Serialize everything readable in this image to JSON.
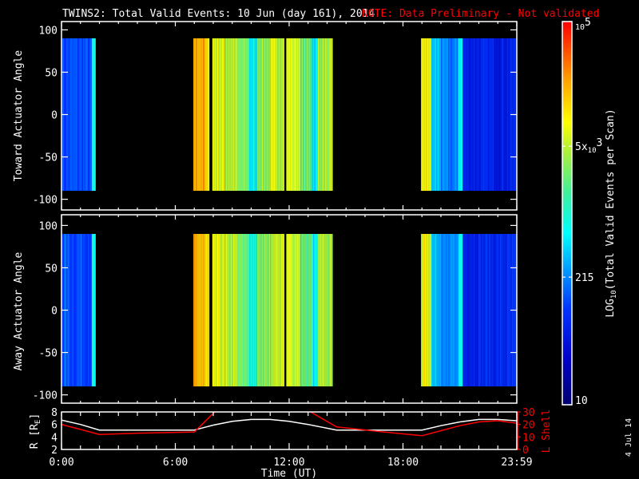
{
  "title": {
    "main": "TWINS2: Total Valid Events: 10 Jun (day 161), 2014",
    "note": "NOTE: Data Preliminary - Not validated"
  },
  "side_date": "4 Jul 14",
  "colors": {
    "note": "#ff0000",
    "axes": "#ffffff",
    "r_line": "#ffffff",
    "l_line": "#ff0000",
    "background": "#000000"
  },
  "chart_data": [
    {
      "type": "heatmap",
      "name": "toward",
      "ylabel": "Toward Actuator Angle",
      "ylim": [
        -100,
        100
      ],
      "yticks": [
        "100",
        "50",
        "0",
        "-50",
        "-100"
      ],
      "ytick_values": [
        100,
        50,
        0,
        -50,
        -100
      ],
      "angle_range": [
        -90,
        90
      ],
      "xlim_hours": [
        0,
        24
      ],
      "segments": [
        {
          "start": 0.0,
          "end": 1.6,
          "count": 120
        },
        {
          "start": 1.6,
          "end": 1.8,
          "count": 650
        },
        {
          "start": 6.95,
          "end": 7.55,
          "count": 22000
        },
        {
          "start": 7.55,
          "end": 7.8,
          "count": 11000
        },
        {
          "start": 7.95,
          "end": 8.6,
          "count": 7000
        },
        {
          "start": 8.6,
          "end": 9.3,
          "count": 5200
        },
        {
          "start": 9.3,
          "end": 9.9,
          "count": 2600
        },
        {
          "start": 9.9,
          "end": 10.3,
          "count": 600
        },
        {
          "start": 10.3,
          "end": 11.0,
          "count": 3600
        },
        {
          "start": 11.0,
          "end": 11.75,
          "count": 6000
        },
        {
          "start": 11.85,
          "end": 12.6,
          "count": 6500
        },
        {
          "start": 12.6,
          "end": 13.2,
          "count": 2400
        },
        {
          "start": 13.2,
          "end": 13.5,
          "count": 500
        },
        {
          "start": 13.5,
          "end": 14.3,
          "count": 4200
        },
        {
          "start": 18.95,
          "end": 19.5,
          "count": 9000
        },
        {
          "start": 19.5,
          "end": 20.0,
          "count": 400
        },
        {
          "start": 20.0,
          "end": 20.9,
          "count": 180
        },
        {
          "start": 20.9,
          "end": 21.15,
          "count": 650
        },
        {
          "start": 21.15,
          "end": 24.0,
          "count": 70
        }
      ]
    },
    {
      "type": "heatmap",
      "name": "away",
      "ylabel": "Away Actuator Angle",
      "ylim": [
        -100,
        100
      ],
      "yticks": [
        "100",
        "50",
        "0",
        "-50",
        "-100"
      ],
      "ytick_values": [
        100,
        50,
        0,
        -50,
        -100
      ],
      "angle_range": [
        -90,
        90
      ],
      "xlim_hours": [
        0,
        24
      ],
      "segments": [
        {
          "start": 0.0,
          "end": 1.6,
          "count": 130
        },
        {
          "start": 1.6,
          "end": 1.8,
          "count": 700
        },
        {
          "start": 6.95,
          "end": 7.55,
          "count": 18000
        },
        {
          "start": 7.55,
          "end": 7.8,
          "count": 10000
        },
        {
          "start": 7.95,
          "end": 8.6,
          "count": 6500
        },
        {
          "start": 8.6,
          "end": 9.3,
          "count": 4800
        },
        {
          "start": 9.3,
          "end": 9.9,
          "count": 2400
        },
        {
          "start": 9.9,
          "end": 10.3,
          "count": 700
        },
        {
          "start": 10.3,
          "end": 11.0,
          "count": 3300
        },
        {
          "start": 11.0,
          "end": 11.75,
          "count": 5500
        },
        {
          "start": 11.85,
          "end": 12.6,
          "count": 6000
        },
        {
          "start": 12.6,
          "end": 13.2,
          "count": 2200
        },
        {
          "start": 13.2,
          "end": 13.5,
          "count": 550
        },
        {
          "start": 13.5,
          "end": 14.3,
          "count": 4000
        },
        {
          "start": 18.95,
          "end": 19.5,
          "count": 8000
        },
        {
          "start": 19.5,
          "end": 20.0,
          "count": 450
        },
        {
          "start": 20.0,
          "end": 20.9,
          "count": 190
        },
        {
          "start": 20.9,
          "end": 21.15,
          "count": 700
        },
        {
          "start": 21.15,
          "end": 24.0,
          "count": 80
        }
      ]
    },
    {
      "type": "line",
      "name": "orbit",
      "xlabel": "Time (UT)",
      "xticks": [
        "0:00",
        "6:00",
        "12:00",
        "18:00",
        "23:59"
      ],
      "xtick_hours": [
        0,
        6,
        12,
        18,
        24
      ],
      "ylabel_left_main": "R [R",
      "ylabel_left_sub": "E",
      "ylabel_left_end": "]",
      "ylabel_right": "L Shell",
      "ylim_left": [
        2,
        8
      ],
      "ylim_right": [
        0,
        30
      ],
      "yticks_left": [
        "2",
        "4",
        "6",
        "8"
      ],
      "yticks_right": [
        "0",
        "10",
        "20",
        "30"
      ],
      "series": [
        {
          "name": "R",
          "axis": "left",
          "color": "#ffffff",
          "x": [
            0,
            1,
            2,
            4,
            7,
            8,
            9,
            10,
            11,
            12,
            13,
            14.5,
            17,
            19,
            20,
            21,
            22,
            23,
            24
          ],
          "y": [
            6.7,
            6.0,
            5.1,
            5.1,
            5.1,
            5.9,
            6.5,
            6.8,
            6.8,
            6.5,
            6.0,
            5.1,
            5.1,
            5.1,
            5.8,
            6.4,
            6.8,
            6.8,
            6.6
          ]
        },
        {
          "name": "L Shell",
          "axis": "right",
          "color": "#ff0000",
          "x": [
            0,
            1,
            2,
            4,
            7,
            8.2,
            12.9,
            14.5,
            17,
            19,
            20,
            21,
            22,
            23,
            24
          ],
          "y": [
            20,
            16,
            12,
            13,
            14,
            32,
            32,
            18,
            14,
            11,
            15,
            19,
            22,
            23,
            21
          ]
        }
      ]
    },
    {
      "type": "colorbar",
      "label_main": "LOG",
      "label_sub": "10",
      "label_end": "(Total Valid Events per Scan)",
      "range": [
        10,
        100000
      ],
      "scale": "log",
      "ticks": [
        {
          "value": 100000,
          "base": "10",
          "exp": "5",
          "pre": ""
        },
        {
          "value": 5000,
          "base": "10",
          "exp": "3",
          "pre": "5x"
        },
        {
          "value": 215,
          "plain": "215"
        },
        {
          "value": 10,
          "plain": "10"
        }
      ]
    }
  ]
}
